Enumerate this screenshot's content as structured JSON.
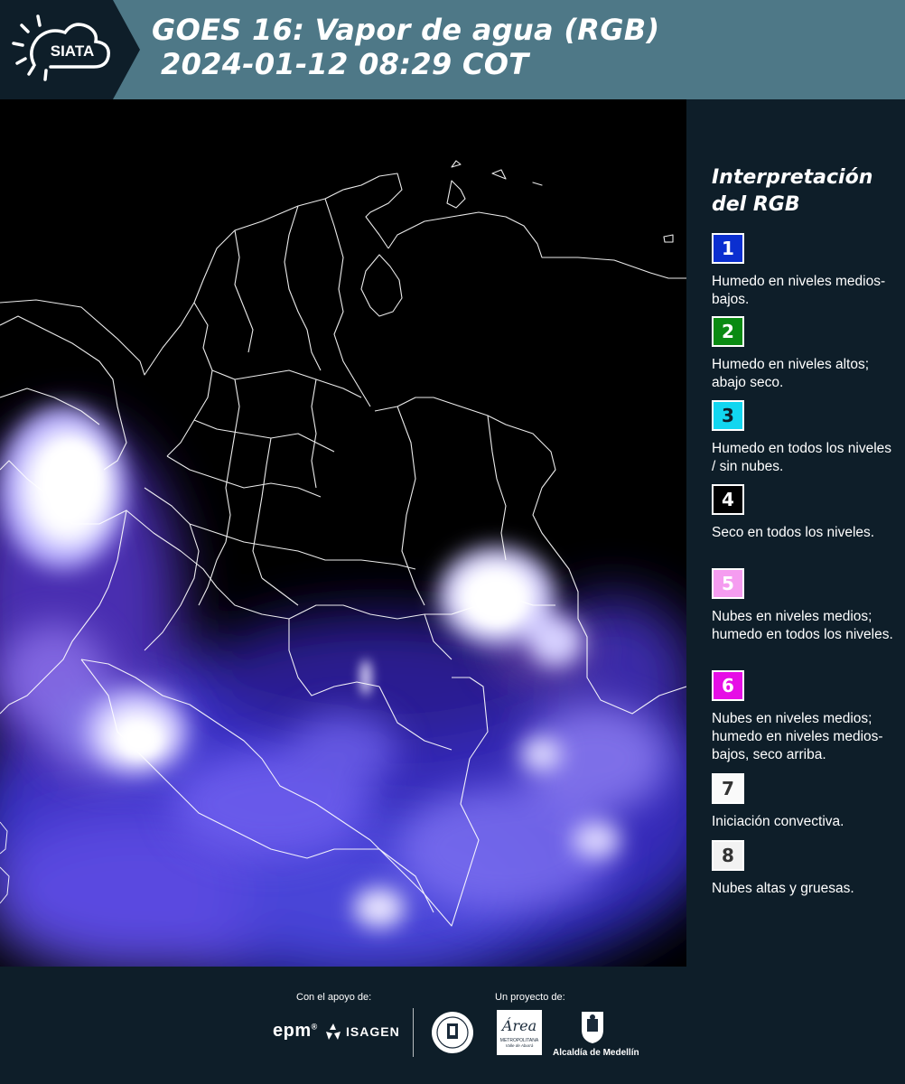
{
  "header": {
    "logo_text": "SIATA",
    "title_line1": "GOES 16: Vapor de agua (RGB)",
    "title_line2": "2024-01-12 08:29 COT"
  },
  "legend": {
    "title_line1": "Interpretación",
    "title_line2": "del RGB",
    "items": [
      {
        "number": "1",
        "color": "#0b2fd0",
        "text_color": "#ffffff",
        "description": "Humedo en niveles medios-bajos."
      },
      {
        "number": "2",
        "color": "#0a8a12",
        "text_color": "#ffffff",
        "description": "Humedo en niveles altos; abajo seco."
      },
      {
        "number": "3",
        "color": "#12d6f0",
        "text_color": "#0e1e29",
        "description": "Humedo en todos los niveles / sin nubes."
      },
      {
        "number": "4",
        "color": "#000000",
        "text_color": "#ffffff",
        "description": "Seco en todos los niveles."
      },
      {
        "number": "5",
        "color": "#f59cf0",
        "text_color": "#ffffff",
        "description": "Nubes en niveles medios; humedo en todos los niveles."
      },
      {
        "number": "6",
        "color": "#e60ee6",
        "text_color": "#ffffff",
        "description": "Nubes en niveles medios; humedo en niveles medios-bajos, seco arriba."
      },
      {
        "number": "7",
        "color": "#fafafa",
        "text_color": "#333333",
        "description": "Iniciación convectiva."
      },
      {
        "number": "8",
        "color": "#f2f2f2",
        "text_color": "#333333",
        "description": "Nubes altas y gruesas."
      }
    ]
  },
  "footer": {
    "support_label": "Con el apoyo de:",
    "project_label": "Un proyecto de:",
    "epm": "epm",
    "isagen": "ISAGEN",
    "area_metropolitana": "Área",
    "area_sub": "METROPOLITANA",
    "area_sub2": "Valle de Aburrá",
    "alcaldia": "Alcaldía de Medellín"
  },
  "colors": {
    "header_bg": "#4e7887",
    "logo_bg": "#0e1e29",
    "panel_bg": "#0e1e29",
    "cloud_white": "#ffffff",
    "moisture_violet": "#6b4cf0",
    "moisture_blue": "#2e2fb8"
  }
}
